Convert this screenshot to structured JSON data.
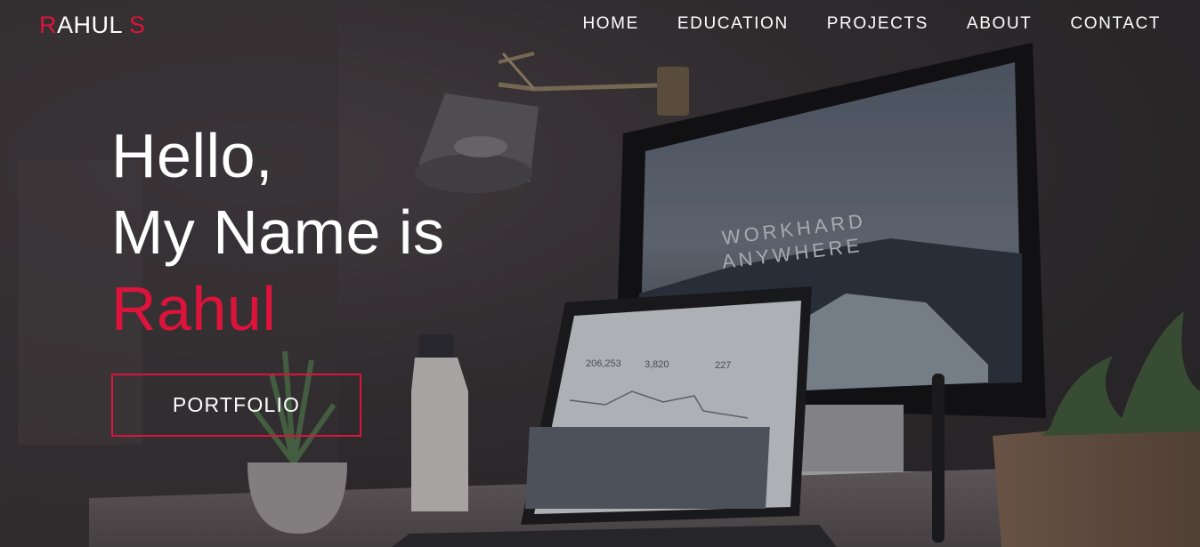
{
  "brand": {
    "first_letter": "R",
    "middle": "AHUL ",
    "last_letter": "S",
    "accent_color": "#dc143c"
  },
  "nav": {
    "items": [
      {
        "label": "HOME"
      },
      {
        "label": "EDUCATION"
      },
      {
        "label": "PROJECTS"
      },
      {
        "label": "ABOUT"
      },
      {
        "label": "CONTACT"
      }
    ]
  },
  "hero": {
    "line1": "Hello,",
    "line2": "My Name is",
    "name": "Rahul",
    "cta_label": "PORTFOLIO"
  },
  "background": {
    "monitor_headline_1": "WORKHARD",
    "monitor_headline_2": "ANYWHERE",
    "stats": [
      "206,253",
      "3,820",
      "227"
    ]
  }
}
